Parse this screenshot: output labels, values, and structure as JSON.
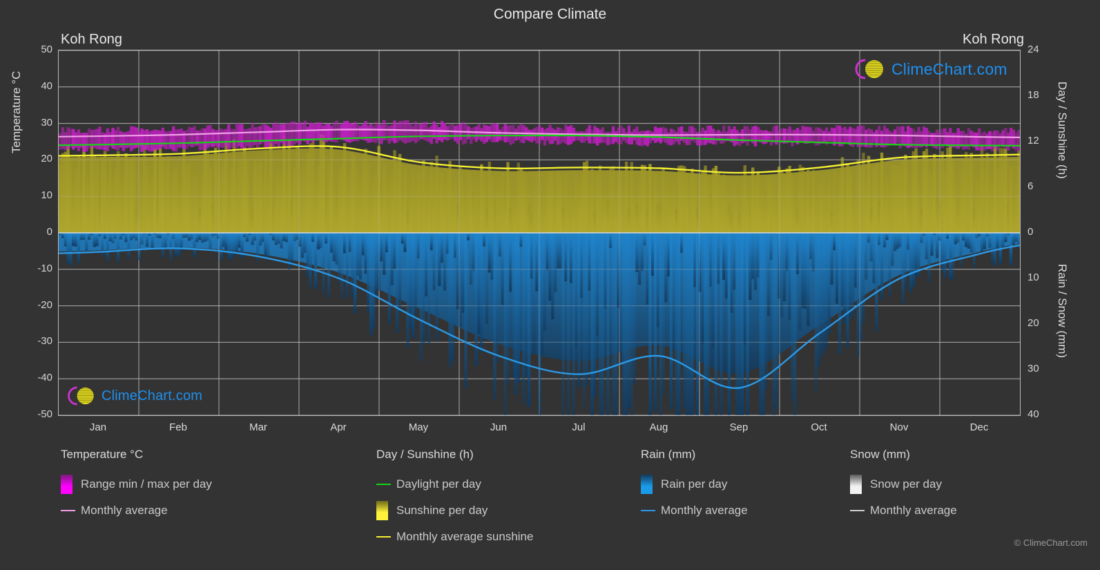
{
  "header": {
    "title": "Compare Climate",
    "location_left": "Koh Rong",
    "location_right": "Koh Rong"
  },
  "watermark": {
    "text": "ClimeChart.com",
    "copyright": "© ClimeChart.com",
    "ring_color": "#cc33cc",
    "sphere_color": "#e8e020",
    "text_color": "#1e90f0"
  },
  "legend": {
    "groups": [
      {
        "title": "Temperature °C",
        "items": [
          {
            "label": "Range min / max per day",
            "marker": "gradient",
            "color": "#ff00ff",
            "color2": "#7a1a7a"
          },
          {
            "label": "Monthly average",
            "marker": "line",
            "color": "#f2a0e8"
          }
        ]
      },
      {
        "title": "Day / Sunshine (h)",
        "items": [
          {
            "label": "Daylight per day",
            "marker": "line",
            "color": "#17d417"
          },
          {
            "label": "Sunshine per day",
            "marker": "gradient",
            "color": "#fff23a",
            "color2": "#6e6a18"
          },
          {
            "label": "Monthly average sunshine",
            "marker": "line",
            "color": "#f5f030"
          }
        ]
      },
      {
        "title": "Rain (mm)",
        "items": [
          {
            "label": "Rain per day",
            "marker": "gradient",
            "color": "#1a9ae8",
            "color2": "#123a5e"
          },
          {
            "label": "Monthly average",
            "marker": "line",
            "color": "#2b9ae8"
          }
        ]
      },
      {
        "title": "Snow (mm)",
        "items": [
          {
            "label": "Snow per day",
            "marker": "gradient",
            "color": "#f2f2f2",
            "color2": "#5a5a5a"
          },
          {
            "label": "Monthly average",
            "marker": "line",
            "color": "#cfcfcf"
          }
        ]
      }
    ]
  },
  "chart_data": {
    "type": "area",
    "title": "Compare Climate",
    "location": "Koh Rong",
    "x": [
      "Jan",
      "Feb",
      "Mar",
      "Apr",
      "May",
      "Jun",
      "Jul",
      "Aug",
      "Sep",
      "Oct",
      "Nov",
      "Dec"
    ],
    "xlabel": "",
    "grid": true,
    "axes": {
      "left": {
        "label": "Temperature °C",
        "ticks": [
          50,
          40,
          30,
          20,
          10,
          0,
          -10,
          -20,
          -30,
          -40,
          -50
        ],
        "range": [
          -50,
          50
        ]
      },
      "right_top": {
        "label": "Day / Sunshine (h)",
        "ticks": [
          24,
          18,
          12,
          6,
          0
        ],
        "range": [
          0,
          24
        ]
      },
      "right_bottom": {
        "label": "Rain / Snow (mm)",
        "ticks": [
          0,
          10,
          20,
          30,
          40
        ],
        "range": [
          0,
          40
        ]
      }
    },
    "series": [
      {
        "name": "Range min / max per day",
        "type": "band",
        "unit": "°C",
        "color": "#c020c0",
        "min": [
          23.4,
          23.6,
          24.4,
          25.4,
          25.6,
          25.3,
          25.1,
          25.0,
          25.0,
          24.9,
          24.4,
          23.6
        ],
        "max": [
          28.2,
          28.6,
          29.4,
          30.1,
          29.9,
          29.1,
          28.6,
          28.4,
          28.5,
          28.6,
          28.4,
          28.0
        ]
      },
      {
        "name": "Monthly average temperature",
        "type": "line",
        "unit": "°C",
        "color": "#f2a0e8",
        "values": [
          26.5,
          26.9,
          27.6,
          28.3,
          28.1,
          27.4,
          27.0,
          26.8,
          26.9,
          26.9,
          26.7,
          26.3
        ]
      },
      {
        "name": "Daylight per day",
        "type": "line",
        "unit": "h",
        "color": "#17d417",
        "values": [
          11.6,
          11.8,
          12.1,
          12.4,
          12.7,
          12.8,
          12.8,
          12.6,
          12.2,
          11.9,
          11.6,
          11.5
        ]
      },
      {
        "name": "Sunshine per day",
        "type": "bars",
        "unit": "h",
        "color": "#b5ad2e",
        "values": [
          10.3,
          10.4,
          11.2,
          11.3,
          9.2,
          8.4,
          8.5,
          8.4,
          7.8,
          8.5,
          9.9,
          10.2
        ]
      },
      {
        "name": "Monthly average sunshine",
        "type": "line",
        "unit": "h",
        "color": "#f5f030",
        "values": [
          10.2,
          10.4,
          11.1,
          11.3,
          9.3,
          8.5,
          8.6,
          8.5,
          7.9,
          8.6,
          9.9,
          10.2
        ]
      },
      {
        "name": "Rain per day",
        "type": "bars",
        "unit": "mm",
        "color": "#1a7ac0",
        "values": [
          4.2,
          3.5,
          5.0,
          9.5,
          18.0,
          26.5,
          30.5,
          26.8,
          33.5,
          22.0,
          10.0,
          4.5
        ]
      },
      {
        "name": "Monthly average rain",
        "type": "line",
        "unit": "mm",
        "color": "#2b9ae8",
        "values": [
          4.2,
          3.4,
          5.2,
          10.0,
          19.0,
          27.0,
          31.0,
          27.0,
          34.0,
          22.0,
          10.0,
          4.6
        ]
      },
      {
        "name": "Snow per day",
        "type": "bars",
        "unit": "mm",
        "color": "#cfcfcf",
        "values": [
          0,
          0,
          0,
          0,
          0,
          0,
          0,
          0,
          0,
          0,
          0,
          0
        ]
      }
    ]
  }
}
